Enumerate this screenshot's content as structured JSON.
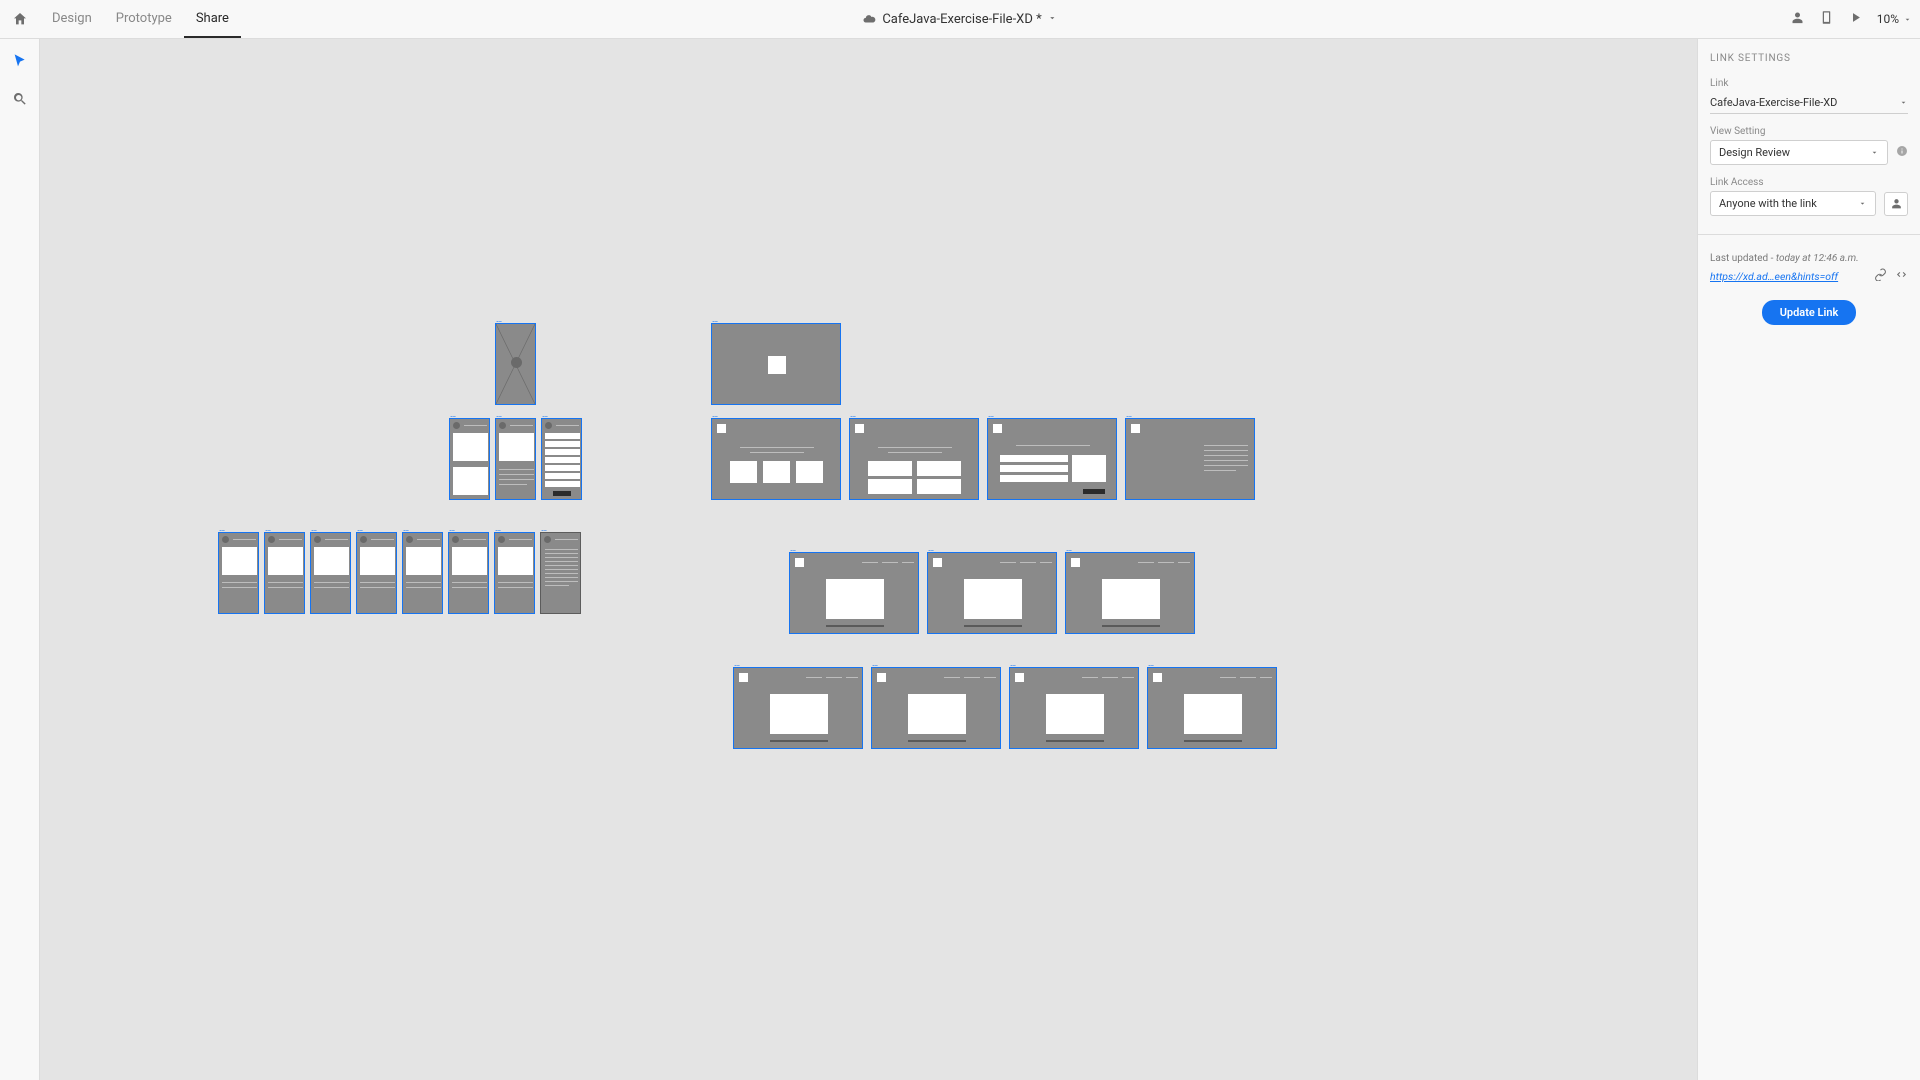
{
  "header": {
    "tabs": [
      "Design",
      "Prototype",
      "Share"
    ],
    "active_tab": 2,
    "document_title": "CafeJava-Exercise-File-XD *",
    "zoom": "10%"
  },
  "panel": {
    "heading": "LINK SETTINGS",
    "link_label": "Link",
    "link_value": "CafeJava-Exercise-File-XD",
    "view_setting_label": "View Setting",
    "view_setting_value": "Design Review",
    "link_access_label": "Link Access",
    "link_access_value": "Anyone with the link",
    "last_updated_prefix": "Last updated - ",
    "last_updated_time": "today at 12:46 a.m.",
    "share_url": "https://xd.ad…een&hints=off",
    "update_button": "Update Link"
  },
  "canvas": {
    "artboard_groups": [
      {
        "id": "mobile-hero",
        "count": 1
      },
      {
        "id": "mobile-row2",
        "count": 3
      },
      {
        "id": "mobile-row3",
        "count": 8
      },
      {
        "id": "desktop-hero",
        "count": 1
      },
      {
        "id": "desktop-row2",
        "count": 4
      },
      {
        "id": "desktop-row3",
        "count": 3
      },
      {
        "id": "desktop-row4",
        "count": 4
      }
    ]
  }
}
